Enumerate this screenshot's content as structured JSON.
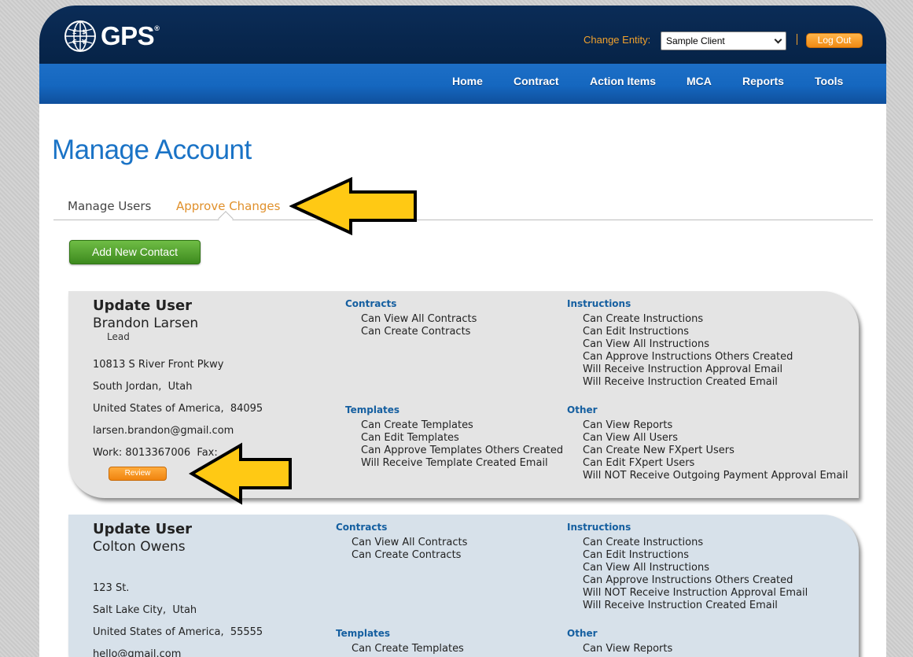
{
  "header": {
    "logo_text": "GPS",
    "logo_mark": "®",
    "entity_label": "Change Entity:",
    "entity_value": "Sample Client",
    "logout_label": "Log Out"
  },
  "nav": {
    "items": [
      "Home",
      "Contract",
      "Action Items",
      "MCA",
      "Reports",
      "Tools"
    ]
  },
  "page": {
    "title": "Manage Account",
    "tabs": [
      {
        "label": "Manage Users",
        "active": false
      },
      {
        "label": "Approve Changes",
        "active": true
      }
    ],
    "add_button": "Add New Contact"
  },
  "cards": [
    {
      "title": "Update User",
      "name": "Brandon  Larsen",
      "role": "Lead",
      "address": "10813 S River Front Pkwy",
      "city": "South Jordan,  Utah",
      "country": "United States of America,  84095",
      "email": "larsen.brandon@gmail.com",
      "phone": "Work: 8013367006  Fax:",
      "review_label": "Review",
      "contracts_title": "Contracts",
      "contracts": [
        "Can View All Contracts",
        "Can Create Contracts"
      ],
      "templates_title": "Templates",
      "templates": [
        "Can Create Templates",
        "Can Edit Templates",
        "Can Approve Templates Others Created",
        "Will Receive Template Created Email"
      ],
      "instructions_title": "Instructions",
      "instructions": [
        "Can Create Instructions",
        "Can Edit Instructions",
        "Can View All Instructions",
        "Can Approve Instructions Others Created",
        "Will Receive Instruction Approval Email",
        "Will Receive Instruction Created Email"
      ],
      "other_title": "Other",
      "other": [
        "Can View Reports",
        "Can View All Users",
        "Can Create New FXpert Users",
        "Can Edit FXpert Users",
        "Will NOT Receive Outgoing Payment Approval Email"
      ]
    },
    {
      "title": "Update User",
      "name": "Colton  Owens",
      "address": "123 St.",
      "city": "Salt Lake City,  Utah",
      "country": "United States of America,  55555",
      "email": "hello@gmail.com",
      "contracts_title": "Contracts",
      "contracts": [
        "Can View All Contracts",
        "Can Create Contracts"
      ],
      "templates_title": "Templates",
      "templates": [
        "Can Create Templates"
      ],
      "instructions_title": "Instructions",
      "instructions": [
        "Can Create Instructions",
        "Can Edit Instructions",
        "Can View All Instructions",
        "Can Approve Instructions Others Created",
        "Will NOT Receive Instruction Approval Email",
        "Will Receive Instruction Created Email"
      ],
      "other_title": "Other",
      "other": [
        "Can View Reports"
      ]
    }
  ],
  "colors": {
    "header_bg": "#062347",
    "nav_bg": "#1567bf",
    "accent_orange": "#f0a12c",
    "title_blue": "#1a73c6",
    "section_blue": "#155fa0",
    "annotation_arrow": "#ffc914"
  },
  "icons": {
    "logo": "globe-currency-icon",
    "select": "chevron-down-icon",
    "annotation": "arrow-left-icon"
  }
}
